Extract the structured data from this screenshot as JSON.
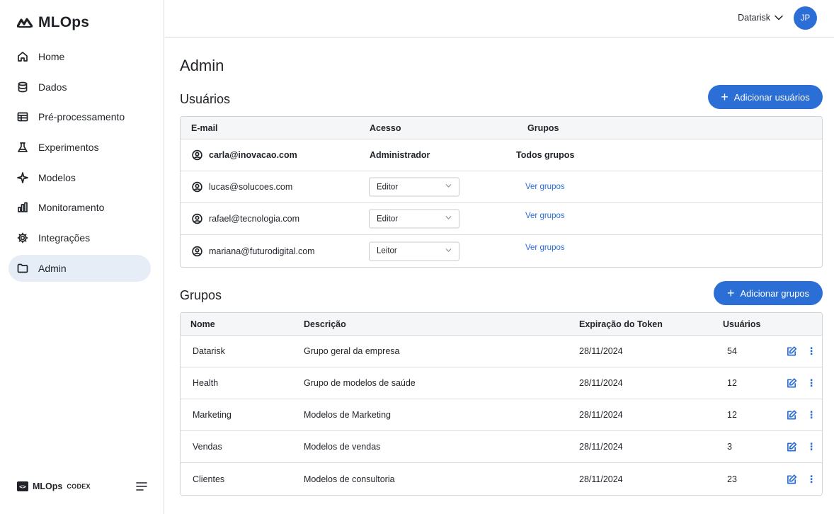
{
  "app": {
    "name": "MLOps"
  },
  "sidebar": {
    "items": [
      {
        "label": "Home",
        "icon": "home-icon"
      },
      {
        "label": "Dados",
        "icon": "database-icon"
      },
      {
        "label": "Pré-processamento",
        "icon": "table-icon"
      },
      {
        "label": "Experimentos",
        "icon": "flask-icon"
      },
      {
        "label": "Modelos",
        "icon": "sparkle-icon"
      },
      {
        "label": "Monitoramento",
        "icon": "bar-chart-icon"
      },
      {
        "label": "Integrações",
        "icon": "gear-icon"
      },
      {
        "label": "Admin",
        "icon": "folder-icon",
        "active": true
      }
    ],
    "footer": {
      "brand": "MLOps",
      "suffix": "CODEX"
    }
  },
  "header": {
    "org": "Datarisk",
    "avatar_initials": "JP"
  },
  "main": {
    "title": "Admin",
    "users": {
      "title": "Usuários",
      "add_button": "Adicionar usuários",
      "columns": [
        "E-mail",
        "Acesso",
        "Grupos"
      ],
      "rows": [
        {
          "email": "carla@inovacao.com",
          "access": "Administrador",
          "groups": "Todos grupos",
          "editable": false
        },
        {
          "email": "lucas@solucoes.com",
          "access": "Editor",
          "groups": "Ver grupos",
          "editable": true
        },
        {
          "email": "rafael@tecnologia.com",
          "access": "Editor",
          "groups": "Ver grupos",
          "editable": true
        },
        {
          "email": "mariana@futurodigital.com",
          "access": "Leitor",
          "groups": "Ver grupos",
          "editable": true
        }
      ]
    },
    "groups": {
      "title": "Grupos",
      "add_button": "Adicionar grupos",
      "columns": [
        "Nome",
        "Descrição",
        "Expiração do Token",
        "Usuários"
      ],
      "rows": [
        {
          "name": "Datarisk",
          "description": "Grupo geral da empresa",
          "expiration": "28/11/2024",
          "users": "54"
        },
        {
          "name": "Health",
          "description": "Grupo de modelos de saúde",
          "expiration": "28/11/2024",
          "users": "12"
        },
        {
          "name": "Marketing",
          "description": "Modelos de Marketing",
          "expiration": "28/11/2024",
          "users": "12"
        },
        {
          "name": "Vendas",
          "description": "Modelos de vendas",
          "expiration": "28/11/2024",
          "users": "3"
        },
        {
          "name": "Clientes",
          "description": "Modelos de consultoria",
          "expiration": "28/11/2024",
          "users": "23"
        }
      ]
    }
  }
}
